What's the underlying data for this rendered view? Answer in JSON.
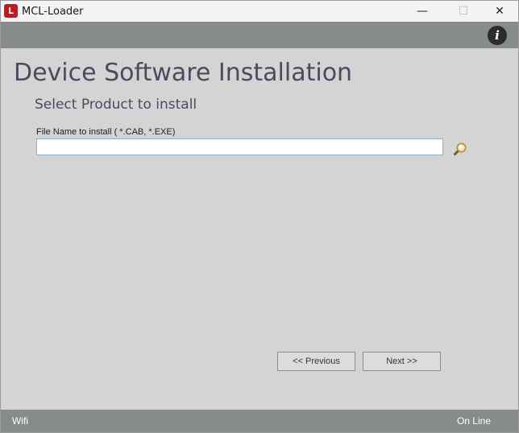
{
  "window": {
    "title": "MCL-Loader",
    "app_icon_text": "L",
    "controls": {
      "minimize": "—",
      "maximize": "☐",
      "close": "✕"
    }
  },
  "header": {
    "info_icon": "i"
  },
  "main": {
    "title": "Device Software Installation",
    "subtitle": "Select Product to install",
    "file_label": "File Name to install ( *.CAB, *.EXE)",
    "file_value": "",
    "file_placeholder": ""
  },
  "navigation": {
    "previous_label": "<<  Previous",
    "next_label": "Next  >>"
  },
  "status": {
    "connection": "Wifi",
    "state": "On Line"
  },
  "colors": {
    "strip": "#878b89",
    "body": "#d4d4d4",
    "title_text": "#4b4b60",
    "app_icon": "#c8161b"
  },
  "icons": {
    "app": "mcl-loader-logo-icon",
    "info": "info-icon",
    "browse": "magnifier-search-icon"
  }
}
